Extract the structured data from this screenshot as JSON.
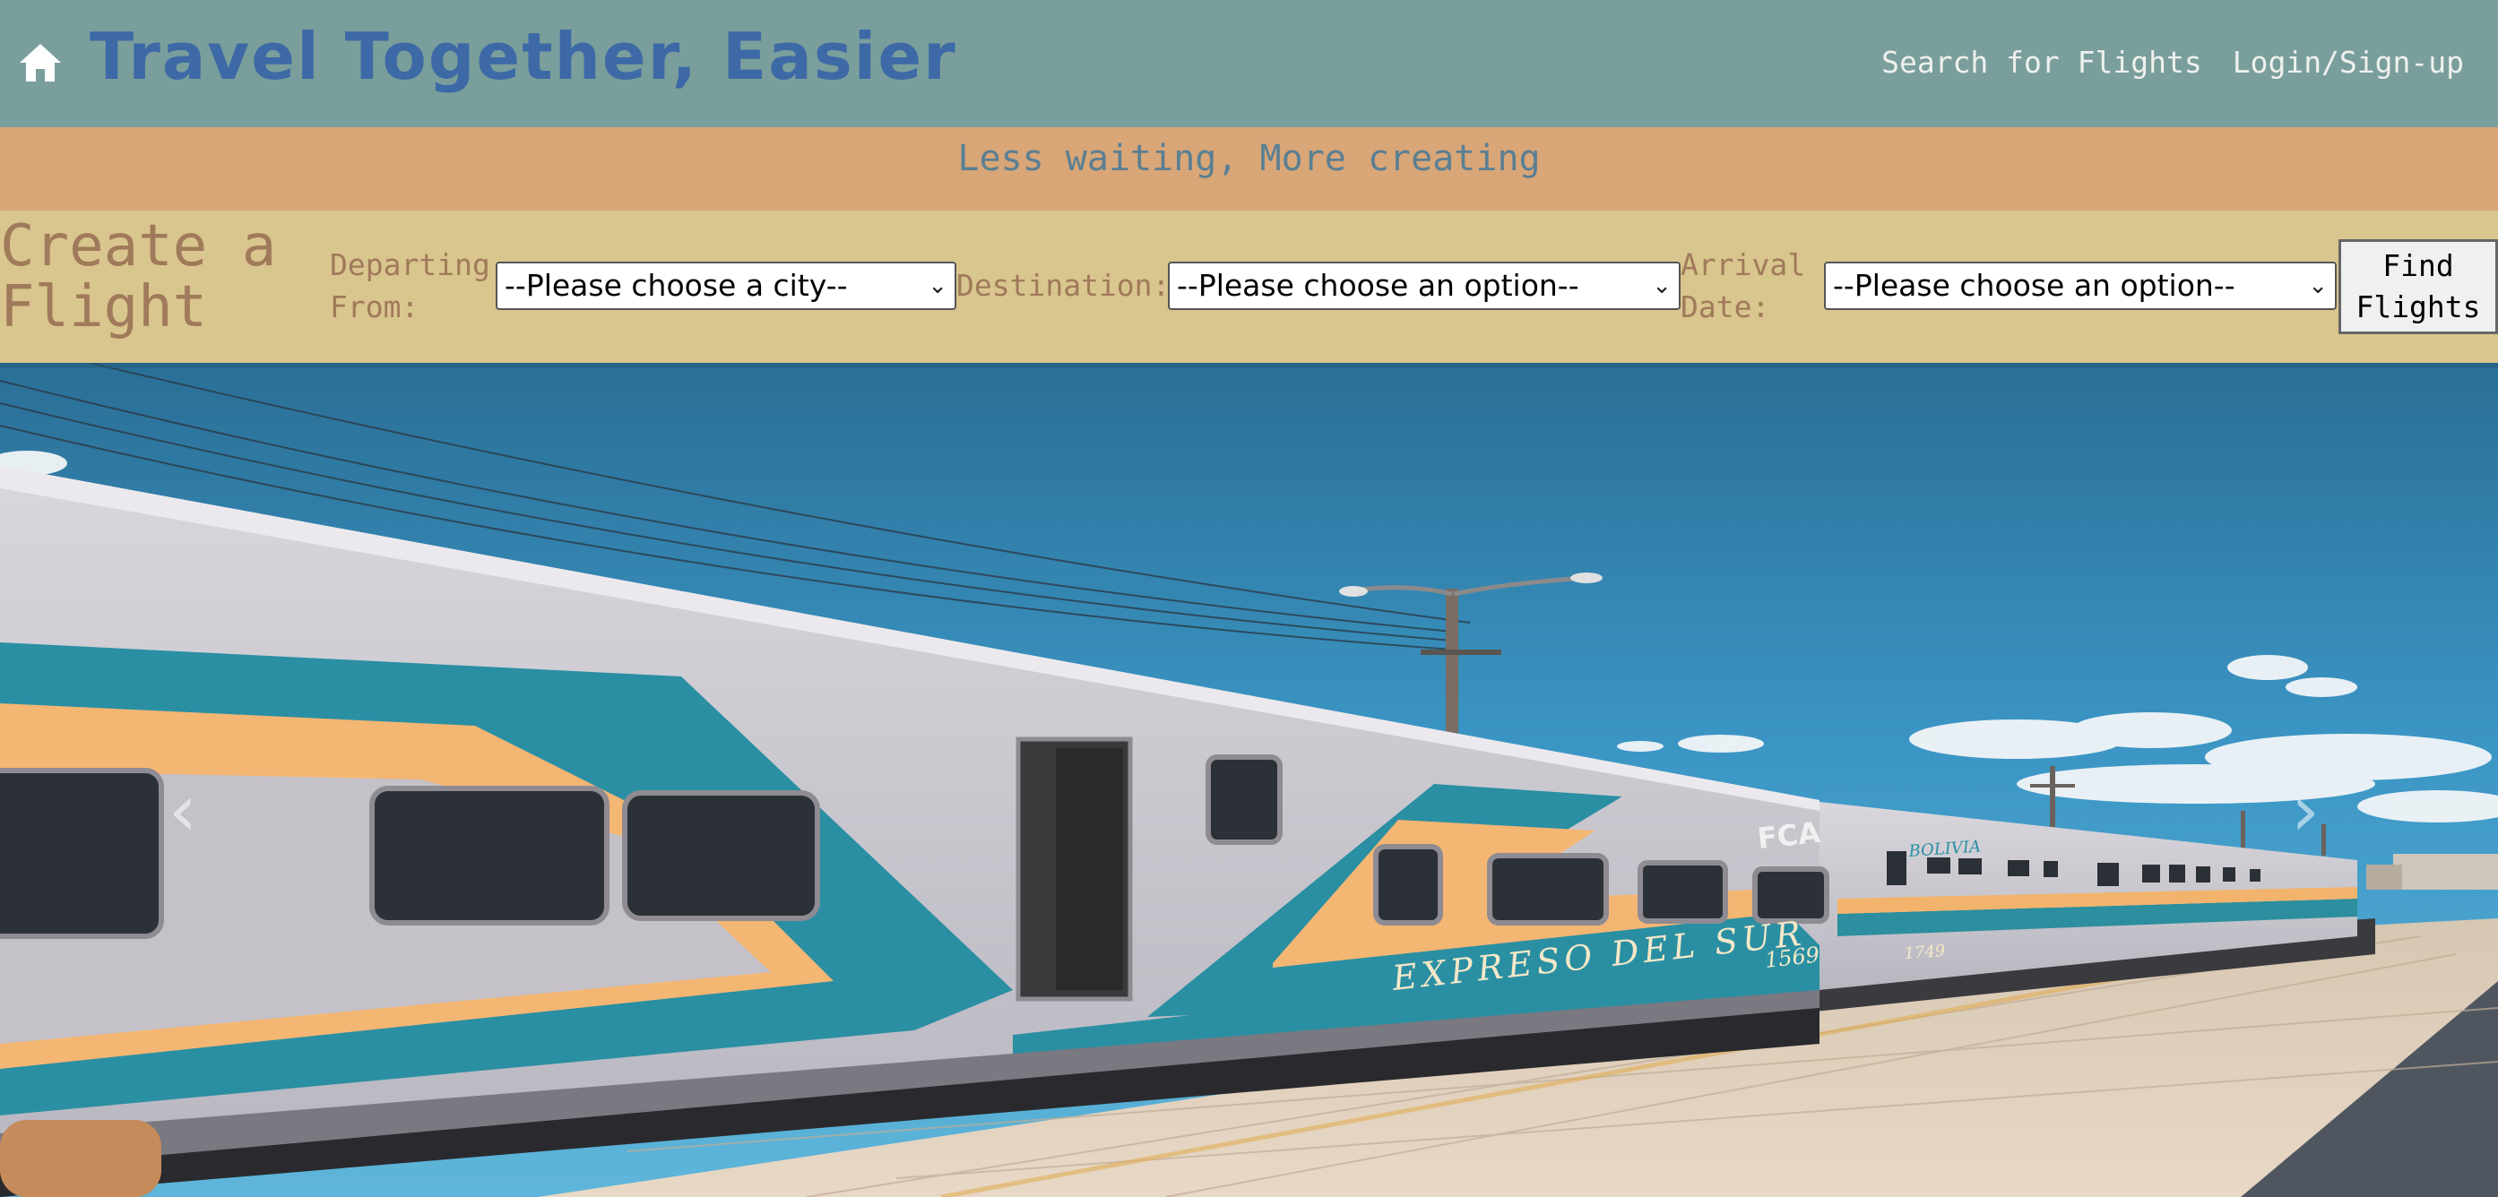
{
  "navbar": {
    "home_icon": "home-icon",
    "brand": "Travel Together, Easier",
    "links": [
      "Search for Flights",
      "Login/Sign-up"
    ]
  },
  "tagline": "Less waiting, More creating",
  "form": {
    "title_line1": "Create a",
    "title_line2": "Flight",
    "departing_label_line1": "Departing",
    "departing_label_line2": "From:",
    "departing_value": "--Please choose a city--",
    "destination_label": "Destination:",
    "destination_value": "--Please choose an option--",
    "arrival_label_line1": "Arrival",
    "arrival_label_line2": "Date:",
    "arrival_value": "--Please choose an option--",
    "submit_line1": "Find",
    "submit_line2": "Flights"
  },
  "hero": {
    "train_text": "EXPRESO DEL SUR",
    "car_number_1": "1569",
    "car_number_2": "1749",
    "logo_text": "FCA",
    "second_car_label": "BOLIVIA",
    "prev_arrow": "‹",
    "next_arrow": "›"
  },
  "colors": {
    "navbar_bg": "#7a9e9c",
    "brand": "#3d6aa6",
    "tagline_bg": "#d9a677",
    "tagline_text": "#5a7f93",
    "form_bg": "#d9c58e",
    "form_text": "#a07a5a"
  }
}
